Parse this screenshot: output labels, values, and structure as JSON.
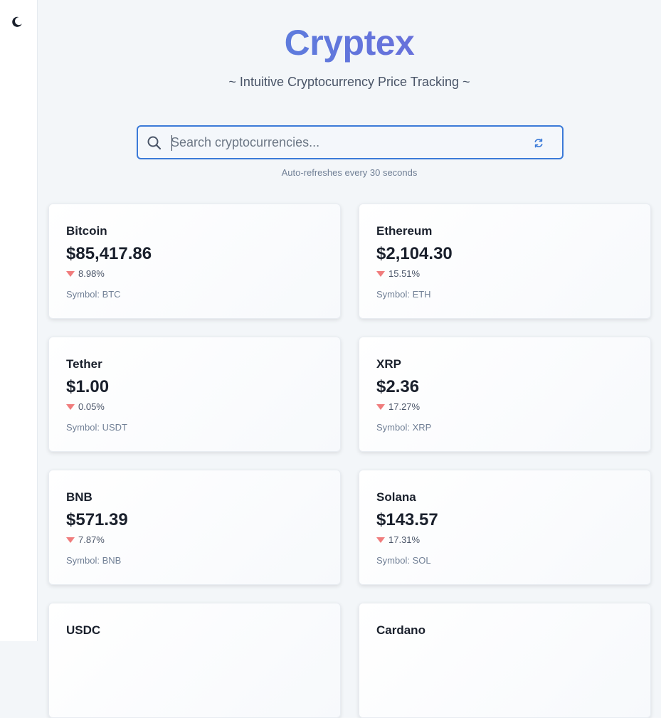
{
  "app": {
    "brand": "Cryptex",
    "tagline": "~ Intuitive Cryptocurrency Price Tracking ~",
    "colors": {
      "accent": "#3b7ad8",
      "gradient_start": "#4a90e2",
      "gradient_end": "#7b5cd6",
      "negative": "#f07c7c"
    }
  },
  "sidebar": {
    "theme_icon": "moon-icon"
  },
  "search": {
    "placeholder": "Search cryptocurrencies...",
    "value": "",
    "refresh_icon": "refresh-icon",
    "search_icon": "search-icon",
    "note": "Auto-refreshes every 30 seconds"
  },
  "coins": [
    {
      "name": "Bitcoin",
      "price": "$85,417.86",
      "change": "8.98%",
      "direction": "down",
      "symbol": "Symbol: BTC"
    },
    {
      "name": "Ethereum",
      "price": "$2,104.30",
      "change": "15.51%",
      "direction": "down",
      "symbol": "Symbol: ETH"
    },
    {
      "name": "Tether",
      "price": "$1.00",
      "change": "0.05%",
      "direction": "down",
      "symbol": "Symbol: USDT"
    },
    {
      "name": "XRP",
      "price": "$2.36",
      "change": "17.27%",
      "direction": "down",
      "symbol": "Symbol: XRP"
    },
    {
      "name": "BNB",
      "price": "$571.39",
      "change": "7.87%",
      "direction": "down",
      "symbol": "Symbol: BNB"
    },
    {
      "name": "Solana",
      "price": "$143.57",
      "change": "17.31%",
      "direction": "down",
      "symbol": "Symbol: SOL"
    },
    {
      "name": "USDC",
      "price": "",
      "change": "",
      "direction": "",
      "symbol": ""
    },
    {
      "name": "Cardano",
      "price": "",
      "change": "",
      "direction": "",
      "symbol": ""
    }
  ]
}
